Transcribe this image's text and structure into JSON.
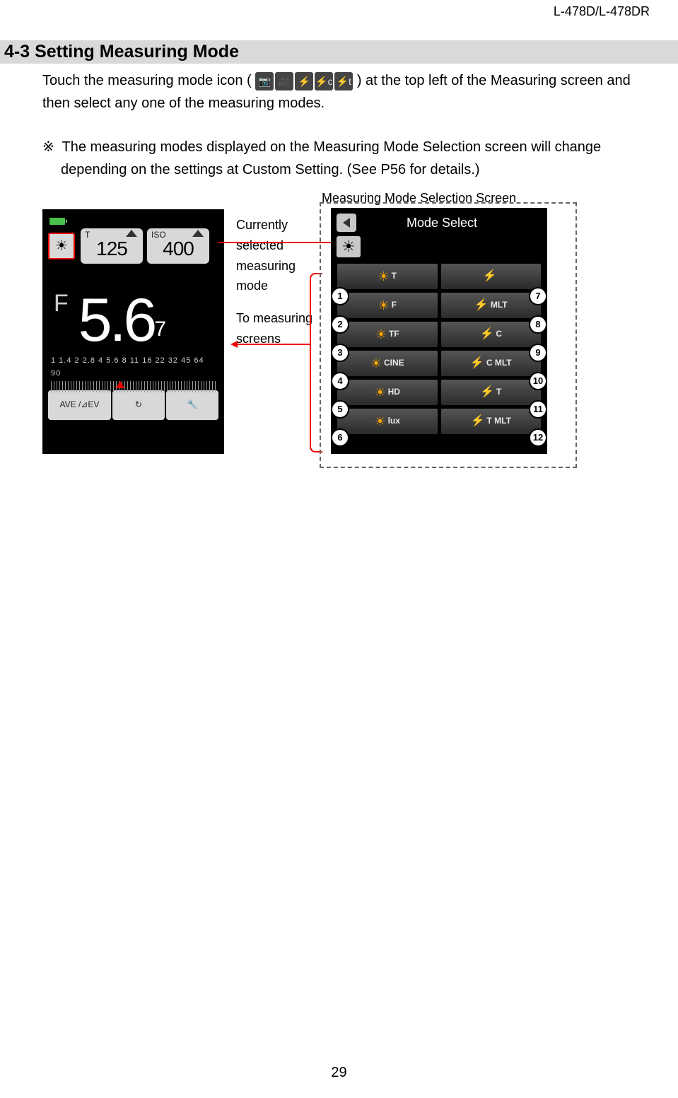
{
  "header": {
    "model": "L-478D/L-478DR"
  },
  "section": {
    "title": "4-3 Setting Measuring Mode"
  },
  "para1": {
    "pre": "Touch the measuring mode icon (",
    "post": " ) at the top left of the Measuring screen and then select any one of the measuring modes."
  },
  "note": {
    "mark": "※",
    "text": "The measuring modes displayed on the Measuring Mode Selection screen will change depending on the settings at Custom Setting. (See P56 for details.)"
  },
  "diagram": {
    "caption": "Measuring Mode Selection Screen",
    "label_current": "Currently selected measuring mode",
    "label_to": "To measuring screens"
  },
  "left_screen": {
    "t_label": "T",
    "iso_label": "ISO",
    "t_value": "125",
    "iso_value": "400",
    "f_label": "F",
    "f_value": "5.6",
    "f_sub": "7",
    "scale_nums": "1  1.4  2  2.8  4  5.6  8  11 16 22 32 45 64 90",
    "btn_ave": "AVE /⊿EV",
    "btn_recycle": "↻",
    "btn_wrench": "🔧"
  },
  "right_screen": {
    "title": "Mode Select",
    "current_icon": "☀",
    "rows": [
      {
        "left": {
          "sun": "☀",
          "txt": "T"
        },
        "right": {
          "bolt": "⚡",
          "txt": ""
        }
      },
      {
        "left": {
          "sun": "☀",
          "txt": "F"
        },
        "right": {
          "bolt": "⚡",
          "txt": "MLT"
        }
      },
      {
        "left": {
          "sun": "☀",
          "txt": "TF"
        },
        "right": {
          "bolt": "⚡",
          "txt": "C"
        }
      },
      {
        "left": {
          "sun": "☀",
          "txt": "CINE"
        },
        "right": {
          "bolt": "⚡",
          "txt": "C MLT"
        }
      },
      {
        "left": {
          "sun": "☀",
          "txt": "HD"
        },
        "right": {
          "bolt": "⚡",
          "txt": "T"
        }
      },
      {
        "left": {
          "sun": "☀",
          "txt": "lux"
        },
        "right": {
          "bolt": "⚡",
          "txt": "T MLT"
        }
      }
    ]
  },
  "callouts": {
    "c1": "1",
    "c2": "2",
    "c3": "3",
    "c4": "4",
    "c5": "5",
    "c6": "6",
    "c7": "7",
    "c8": "8",
    "c9": "9",
    "c10": "10",
    "c11": "11",
    "c12": "12"
  },
  "page_number": "29"
}
